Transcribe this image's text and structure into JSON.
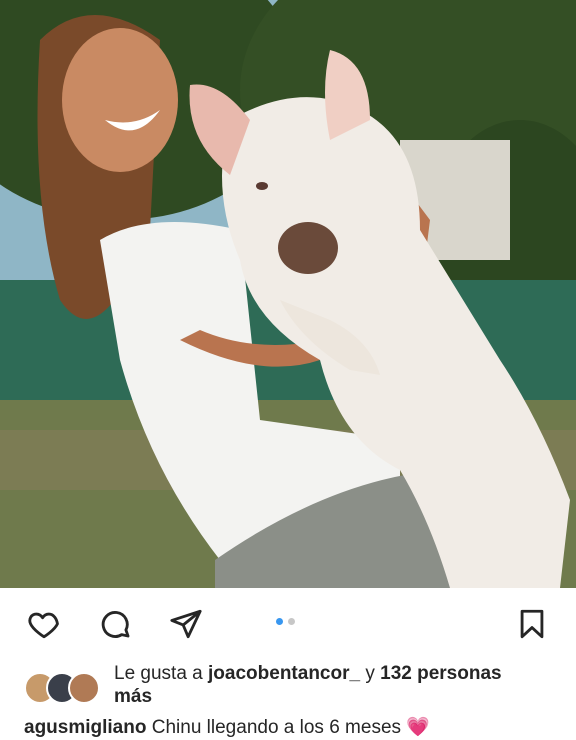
{
  "post": {
    "image_alt": "Woman smiling while holding a white pig outdoors",
    "carousel": {
      "current": 1,
      "total": 2
    },
    "actions": {
      "like_icon": "heart-outline-icon",
      "comment_icon": "comment-bubble-icon",
      "share_icon": "paper-plane-icon",
      "save_icon": "bookmark-icon"
    },
    "likes": {
      "prefix": "Le gusta a",
      "user": "joacobentancor_",
      "connector": "y",
      "count_text": "132 personas",
      "suffix": "más"
    },
    "caption": {
      "username": "agusmigliano",
      "text": "Chinu llegando a los 6 meses",
      "emoji": "💗"
    }
  },
  "colors": {
    "accent_dot": "#3897f0",
    "heart_emoji": "#ff4f9a",
    "text": "#262626"
  }
}
